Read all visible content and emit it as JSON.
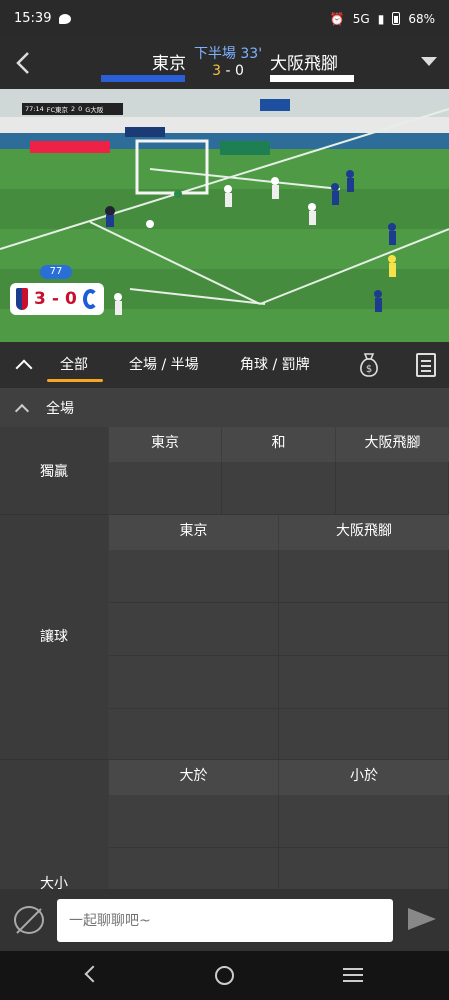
{
  "status_bar": {
    "time": "15:39",
    "network": "5G",
    "battery": "68%"
  },
  "match": {
    "home_team": "東京",
    "away_team": "大阪飛腳",
    "period": "下半場 33'",
    "home_score": "3",
    "separator": "-",
    "away_score": "0"
  },
  "video": {
    "minute_badge": "77",
    "card_home_score": "3",
    "card_separator": "-",
    "card_away_score": "0",
    "minibar": {
      "clock": "77:14",
      "home": "FC東京",
      "home_score": "2",
      "away_score": "0",
      "away": "G大阪"
    }
  },
  "tabs": [
    {
      "label": "全部",
      "active": true
    },
    {
      "label": "全場 / 半場",
      "active": false
    },
    {
      "label": "角球 / 罰牌",
      "active": false
    }
  ],
  "section": {
    "title": "全場"
  },
  "markets": {
    "winner": {
      "label": "獨贏",
      "columns": [
        "東京",
        "和",
        "大阪飛腳"
      ]
    },
    "handicap": {
      "label": "讓球",
      "columns": [
        "東京",
        "大阪飛腳"
      ]
    },
    "total": {
      "label": "大小",
      "columns": [
        "大於",
        "小於"
      ]
    }
  },
  "chat": {
    "placeholder": "一起聊聊吧~"
  },
  "colors": {
    "accent": "#f5a623",
    "home": "#2a5fd8",
    "period": "#7fb2ff",
    "score": "#f5c242"
  }
}
